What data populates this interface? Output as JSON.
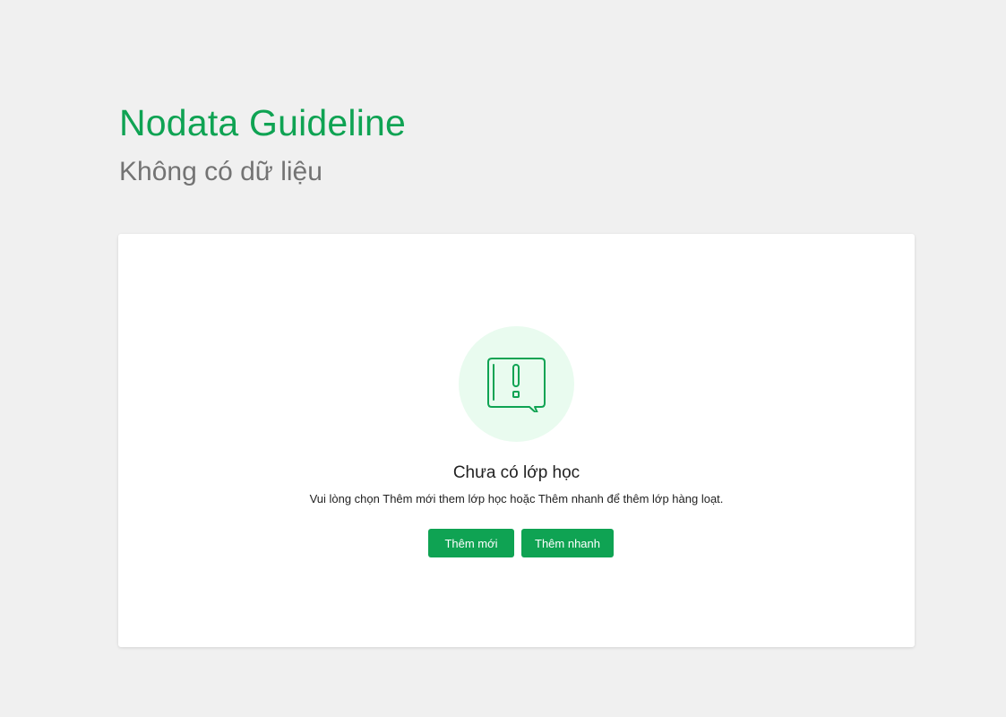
{
  "header": {
    "title": "Nodata Guideline",
    "subtitle": "Không có dữ liệu"
  },
  "empty_state": {
    "icon": "message-alert-icon",
    "title": "Chưa có lớp học",
    "description": "Vui lòng chọn Thêm mới them lớp học hoặc Thêm nhanh để thêm lớp hàng loạt.",
    "buttons": {
      "add_new": "Thêm mới",
      "quick_add": "Thêm nhanh"
    }
  },
  "colors": {
    "accent": "#0fa353",
    "icon_background": "#e9fbef",
    "page_background": "#f0f0f0",
    "subtitle": "#737373"
  }
}
